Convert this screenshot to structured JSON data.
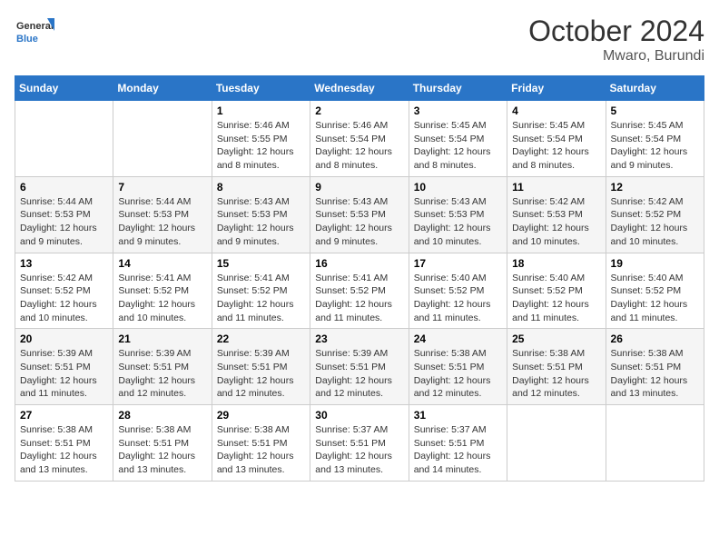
{
  "header": {
    "logo_general": "General",
    "logo_blue": "Blue",
    "month": "October 2024",
    "location": "Mwaro, Burundi"
  },
  "weekdays": [
    "Sunday",
    "Monday",
    "Tuesday",
    "Wednesday",
    "Thursday",
    "Friday",
    "Saturday"
  ],
  "weeks": [
    [
      {
        "day": "",
        "info": ""
      },
      {
        "day": "",
        "info": ""
      },
      {
        "day": "1",
        "sunrise": "Sunrise: 5:46 AM",
        "sunset": "Sunset: 5:55 PM",
        "daylight": "Daylight: 12 hours and 8 minutes."
      },
      {
        "day": "2",
        "sunrise": "Sunrise: 5:46 AM",
        "sunset": "Sunset: 5:54 PM",
        "daylight": "Daylight: 12 hours and 8 minutes."
      },
      {
        "day": "3",
        "sunrise": "Sunrise: 5:45 AM",
        "sunset": "Sunset: 5:54 PM",
        "daylight": "Daylight: 12 hours and 8 minutes."
      },
      {
        "day": "4",
        "sunrise": "Sunrise: 5:45 AM",
        "sunset": "Sunset: 5:54 PM",
        "daylight": "Daylight: 12 hours and 8 minutes."
      },
      {
        "day": "5",
        "sunrise": "Sunrise: 5:45 AM",
        "sunset": "Sunset: 5:54 PM",
        "daylight": "Daylight: 12 hours and 9 minutes."
      }
    ],
    [
      {
        "day": "6",
        "sunrise": "Sunrise: 5:44 AM",
        "sunset": "Sunset: 5:53 PM",
        "daylight": "Daylight: 12 hours and 9 minutes."
      },
      {
        "day": "7",
        "sunrise": "Sunrise: 5:44 AM",
        "sunset": "Sunset: 5:53 PM",
        "daylight": "Daylight: 12 hours and 9 minutes."
      },
      {
        "day": "8",
        "sunrise": "Sunrise: 5:43 AM",
        "sunset": "Sunset: 5:53 PM",
        "daylight": "Daylight: 12 hours and 9 minutes."
      },
      {
        "day": "9",
        "sunrise": "Sunrise: 5:43 AM",
        "sunset": "Sunset: 5:53 PM",
        "daylight": "Daylight: 12 hours and 9 minutes."
      },
      {
        "day": "10",
        "sunrise": "Sunrise: 5:43 AM",
        "sunset": "Sunset: 5:53 PM",
        "daylight": "Daylight: 12 hours and 10 minutes."
      },
      {
        "day": "11",
        "sunrise": "Sunrise: 5:42 AM",
        "sunset": "Sunset: 5:53 PM",
        "daylight": "Daylight: 12 hours and 10 minutes."
      },
      {
        "day": "12",
        "sunrise": "Sunrise: 5:42 AM",
        "sunset": "Sunset: 5:52 PM",
        "daylight": "Daylight: 12 hours and 10 minutes."
      }
    ],
    [
      {
        "day": "13",
        "sunrise": "Sunrise: 5:42 AM",
        "sunset": "Sunset: 5:52 PM",
        "daylight": "Daylight: 12 hours and 10 minutes."
      },
      {
        "day": "14",
        "sunrise": "Sunrise: 5:41 AM",
        "sunset": "Sunset: 5:52 PM",
        "daylight": "Daylight: 12 hours and 10 minutes."
      },
      {
        "day": "15",
        "sunrise": "Sunrise: 5:41 AM",
        "sunset": "Sunset: 5:52 PM",
        "daylight": "Daylight: 12 hours and 11 minutes."
      },
      {
        "day": "16",
        "sunrise": "Sunrise: 5:41 AM",
        "sunset": "Sunset: 5:52 PM",
        "daylight": "Daylight: 12 hours and 11 minutes."
      },
      {
        "day": "17",
        "sunrise": "Sunrise: 5:40 AM",
        "sunset": "Sunset: 5:52 PM",
        "daylight": "Daylight: 12 hours and 11 minutes."
      },
      {
        "day": "18",
        "sunrise": "Sunrise: 5:40 AM",
        "sunset": "Sunset: 5:52 PM",
        "daylight": "Daylight: 12 hours and 11 minutes."
      },
      {
        "day": "19",
        "sunrise": "Sunrise: 5:40 AM",
        "sunset": "Sunset: 5:52 PM",
        "daylight": "Daylight: 12 hours and 11 minutes."
      }
    ],
    [
      {
        "day": "20",
        "sunrise": "Sunrise: 5:39 AM",
        "sunset": "Sunset: 5:51 PM",
        "daylight": "Daylight: 12 hours and 11 minutes."
      },
      {
        "day": "21",
        "sunrise": "Sunrise: 5:39 AM",
        "sunset": "Sunset: 5:51 PM",
        "daylight": "Daylight: 12 hours and 12 minutes."
      },
      {
        "day": "22",
        "sunrise": "Sunrise: 5:39 AM",
        "sunset": "Sunset: 5:51 PM",
        "daylight": "Daylight: 12 hours and 12 minutes."
      },
      {
        "day": "23",
        "sunrise": "Sunrise: 5:39 AM",
        "sunset": "Sunset: 5:51 PM",
        "daylight": "Daylight: 12 hours and 12 minutes."
      },
      {
        "day": "24",
        "sunrise": "Sunrise: 5:38 AM",
        "sunset": "Sunset: 5:51 PM",
        "daylight": "Daylight: 12 hours and 12 minutes."
      },
      {
        "day": "25",
        "sunrise": "Sunrise: 5:38 AM",
        "sunset": "Sunset: 5:51 PM",
        "daylight": "Daylight: 12 hours and 12 minutes."
      },
      {
        "day": "26",
        "sunrise": "Sunrise: 5:38 AM",
        "sunset": "Sunset: 5:51 PM",
        "daylight": "Daylight: 12 hours and 13 minutes."
      }
    ],
    [
      {
        "day": "27",
        "sunrise": "Sunrise: 5:38 AM",
        "sunset": "Sunset: 5:51 PM",
        "daylight": "Daylight: 12 hours and 13 minutes."
      },
      {
        "day": "28",
        "sunrise": "Sunrise: 5:38 AM",
        "sunset": "Sunset: 5:51 PM",
        "daylight": "Daylight: 12 hours and 13 minutes."
      },
      {
        "day": "29",
        "sunrise": "Sunrise: 5:38 AM",
        "sunset": "Sunset: 5:51 PM",
        "daylight": "Daylight: 12 hours and 13 minutes."
      },
      {
        "day": "30",
        "sunrise": "Sunrise: 5:37 AM",
        "sunset": "Sunset: 5:51 PM",
        "daylight": "Daylight: 12 hours and 13 minutes."
      },
      {
        "day": "31",
        "sunrise": "Sunrise: 5:37 AM",
        "sunset": "Sunset: 5:51 PM",
        "daylight": "Daylight: 12 hours and 14 minutes."
      },
      {
        "day": "",
        "info": ""
      },
      {
        "day": "",
        "info": ""
      }
    ]
  ]
}
